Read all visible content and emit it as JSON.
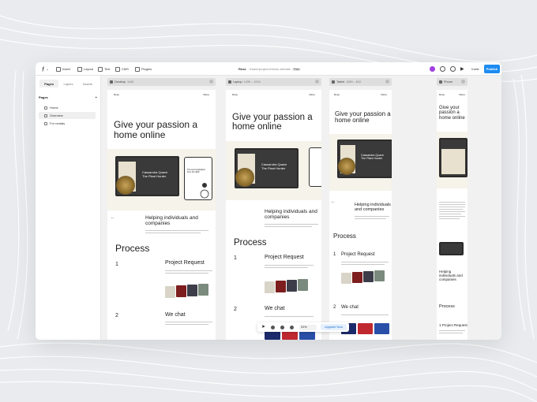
{
  "app": {
    "menu": [
      "Insert",
      "Layout",
      "Text",
      "CMS",
      "Plugins"
    ],
    "title_prefix": "Rose",
    "title_suffix": "· framerproject-freesio website",
    "badge": "Free",
    "invite_label": "Invite",
    "publish_label": "Publish",
    "accent_color": "#1e8cf0"
  },
  "sidebar": {
    "tabs": [
      "Pages",
      "Layers",
      "Assets"
    ],
    "pages_header": "Pages",
    "pages": [
      {
        "label": "Home",
        "icon": "home-icon"
      },
      {
        "label": "Overview",
        "icon": "page-icon"
      },
      {
        "label": "For rentals",
        "icon": "page-icon"
      }
    ]
  },
  "frames": [
    {
      "name": "Desktop",
      "size": "1440"
    },
    {
      "name": "Laptop",
      "size": "1439 – 1024"
    },
    {
      "name": "Tablet",
      "size": "1089 – 810"
    },
    {
      "name": "Phone",
      "size": ""
    }
  ],
  "site": {
    "nav_left": "Rose",
    "nav_right": "Menu",
    "hero_title": "Give your passion a home online",
    "mock_text": "Cassandra Quave The Plant Hunter",
    "phone_text": "The Hunt Highlights from the Wild",
    "section_title": "Helping individuals and companies",
    "process_title": "Process",
    "step1_num": "1",
    "step1_title": "Project Request",
    "step2_num": "2",
    "step2_title": "We chat"
  },
  "float_toolbar": {
    "zoom": "31%",
    "upgrade": "Upgrade Now"
  }
}
